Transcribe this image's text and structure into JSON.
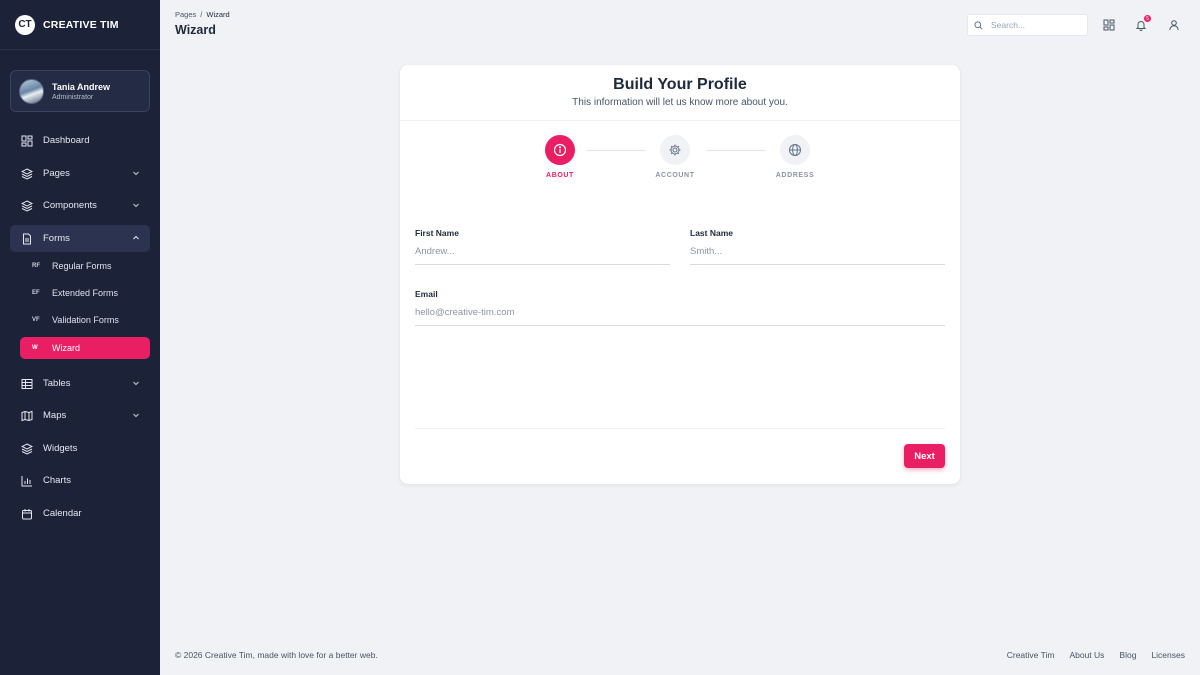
{
  "brand": {
    "logo": "CT",
    "name": "CREATIVE TIM"
  },
  "user": {
    "name": "Tania Andrew",
    "role": "Administrator"
  },
  "sidebar": {
    "items": [
      {
        "label": "Dashboard",
        "icon": "dashboard-icon"
      },
      {
        "label": "Pages",
        "icon": "pages-icon"
      },
      {
        "label": "Components",
        "icon": "components-icon"
      },
      {
        "label": "Forms",
        "icon": "forms-icon"
      },
      {
        "label": "Tables",
        "icon": "tables-icon"
      },
      {
        "label": "Maps",
        "icon": "maps-icon"
      },
      {
        "label": "Widgets",
        "icon": "widgets-icon"
      },
      {
        "label": "Charts",
        "icon": "charts-icon"
      },
      {
        "label": "Calendar",
        "icon": "calendar-icon"
      }
    ],
    "forms_sub": [
      {
        "abbr": "RF",
        "label": "Regular Forms"
      },
      {
        "abbr": "EF",
        "label": "Extended Forms"
      },
      {
        "abbr": "VF",
        "label": "Validation Forms"
      },
      {
        "abbr": "W",
        "label": "Wizard"
      }
    ]
  },
  "header": {
    "breadcrumb_root": "Pages",
    "breadcrumb_sep": "/",
    "breadcrumb_current": "Wizard",
    "title": "Wizard",
    "search_placeholder": "Search...",
    "notification_count": "5"
  },
  "wizard": {
    "title": "Build Your Profile",
    "subtitle": "This information will let us know more about you.",
    "steps": [
      "ABOUT",
      "ACCOUNT",
      "ADDRESS"
    ],
    "fields": {
      "first_name_label": "First Name",
      "first_name_placeholder": "Andrew...",
      "last_name_label": "Last Name",
      "last_name_placeholder": "Smith...",
      "email_label": "Email",
      "email_placeholder": "hello@creative-tim.com"
    },
    "next_label": "Next"
  },
  "footer": {
    "copyright": "© 2026 Creative Tim, made with love for a better web.",
    "links": [
      "Creative Tim",
      "About Us",
      "Blog",
      "Licenses"
    ]
  },
  "colors": {
    "accent": "#e91e63",
    "sidebar_bg": "#1c2238",
    "page_bg": "#f0f2f5"
  }
}
